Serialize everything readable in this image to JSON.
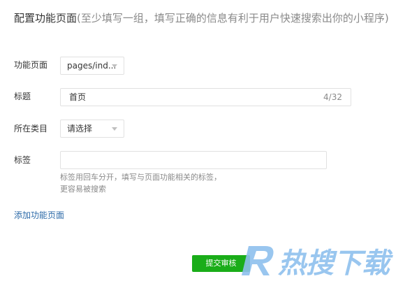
{
  "header": {
    "title_main": "配置功能页面",
    "title_sub": "(至少填写一组，填写正确的信息有利于用户快速搜索出你的小程序)"
  },
  "form": {
    "page": {
      "label": "功能页面",
      "value": "pages/ind..."
    },
    "title": {
      "label": "标题",
      "value": "首页",
      "counter": "4/32"
    },
    "category": {
      "label": "所在类目",
      "value": "请选择"
    },
    "tags": {
      "label": "标签",
      "value": "",
      "hint_line1": "标签用回车分开，填写与页面功能相关的标签，",
      "hint_line2": "更容易被搜索"
    }
  },
  "actions": {
    "add_page_link": "添加功能页面",
    "submit_label": "提交审核"
  },
  "watermark": {
    "text": "热搜下载"
  },
  "colors": {
    "primary_green": "#1aad19",
    "link_blue": "#2c6aa8",
    "border": "#e1e1e1",
    "muted_text": "#8a8a8a"
  }
}
